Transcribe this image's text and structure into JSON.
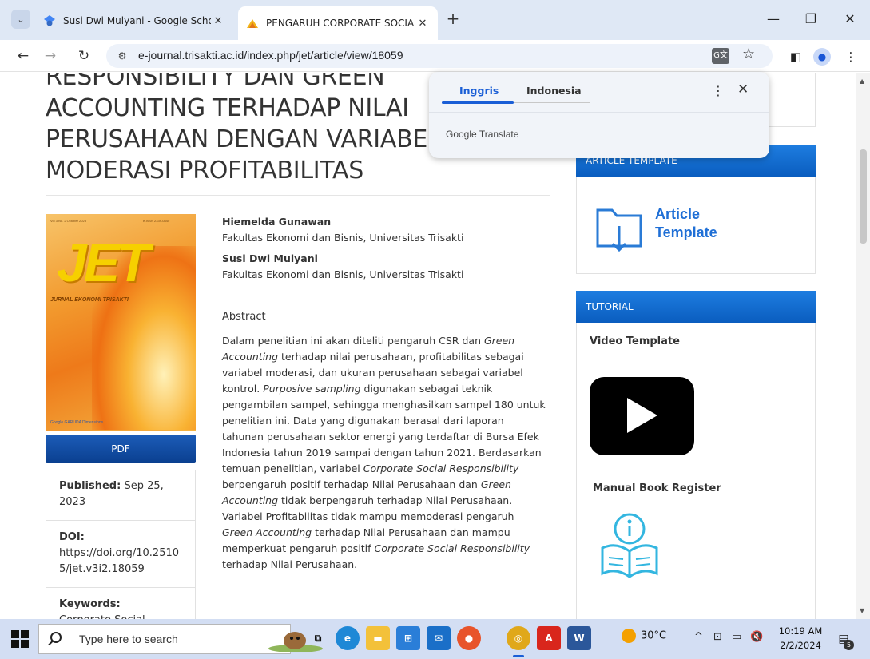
{
  "browser": {
    "tabs": [
      {
        "title": "Susi Dwi Mulyani - Google Scho",
        "active": false
      },
      {
        "title": "PENGARUH CORPORATE SOCIA",
        "active": true
      }
    ],
    "new_tab": "+",
    "close_glyph": "✕",
    "window_controls": {
      "minimize": "—",
      "restore": "❐",
      "close": "✕"
    },
    "url": "e-journal.trisakti.ac.id/index.php/jet/article/view/18059",
    "icons": [
      "tab-search-icon",
      "back-icon",
      "forward-icon",
      "reload-icon",
      "site-info-icon",
      "translate-icon",
      "bookmark-star-icon",
      "side-panel-icon",
      "profile-icon",
      "more-menu-icon"
    ]
  },
  "translate_popup": {
    "tab_selected": "Inggris",
    "tab_other": "Indonesia",
    "brand": "Google Translate",
    "more": "⋮",
    "close": "✕"
  },
  "article": {
    "title_lines": [
      "RESPONSIBILITY DAN GREEN",
      "ACCOUNTING TERHADAP NILAI",
      "PERUSAHAAN DENGAN VARIABEL",
      "MODERASI PROFITABILITAS"
    ],
    "cover": {
      "top_left": "Vol 3 No. 2 Oktober 2023",
      "top_right": "e-ISSN 2339-0840",
      "big": "JET",
      "sub": "JURNAL EKONOMI TRISAKTI",
      "logos": "Google  GARUDA  Dimensions"
    },
    "pdf_label": "PDF",
    "published_label": "Published:",
    "published_value": "Sep 25, 2023",
    "doi_label": "DOI:",
    "doi_line1": "https://doi.org/10.2510",
    "doi_line2": "5/jet.v3i2.18059",
    "keywords_label": "Keywords:",
    "keywords_value": "Corporate Social",
    "authors": [
      {
        "name": "Hiemelda Gunawan",
        "affiliation": "Fakultas Ekonomi dan Bisnis, Universitas Trisakti"
      },
      {
        "name": "Susi Dwi Mulyani",
        "affiliation": "Fakultas Ekonomi dan Bisnis, Universitas Trisakti"
      }
    ],
    "abstract_label": "Abstract",
    "abstract_lines": [
      "Dalam penelitian ini akan diteliti pengaruh CSR dan Green",
      "Accounting terhadap nilai perusahaan, profitabilitas sebagai",
      "variabel moderasi, dan ukuran perusahaan sebagai variabel",
      "kontrol. Purposive sampling digunakan sebagai teknik",
      "pengambilan sampel, sehingga menghasilkan sampel 180 untuk",
      "penelitian ini. Data yang digunakan berasal dari laporan",
      "tahunan perusahaan sektor energi yang terdaftar di Bursa Efek",
      "Indonesia tahun 2019 sampai dengan tahun 2021. Berdasarkan",
      "temuan penelitian, variabel Corporate Social Responsibility",
      "berpengaruh positif terhadap Nilai Perusahaan dan Green",
      "Accounting tidak berpengaruh terhadap Nilai Perusahaan.",
      "Variabel Profitabilitas tidak mampu memoderasi pengaruh",
      "Green Accounting terhadap Nilai Perusahaan dan mampu",
      "memperkuat pengaruh positif Corporate Social Responsibility",
      "terhadap Nilai Perusahaan."
    ]
  },
  "sidebar": {
    "article_template_header": "ARTICLE TEMPLATE",
    "article_template_text_1": "Article",
    "article_template_text_2": "Template",
    "tutorial_header": "TUTORIAL",
    "video_label": "Video Template",
    "manual_label": "Manual Book Register"
  },
  "taskbar": {
    "search_placeholder": "Type here to search",
    "weather": "30°C",
    "time": "10:19 AM",
    "date": "2/2/2024",
    "notification_count": "5",
    "apps": [
      "task-view-icon",
      "edge-icon",
      "file-explorer-icon",
      "store-icon",
      "mail-icon",
      "firefox-icon",
      "chrome-icon",
      "acrobat-icon",
      "word-icon"
    ]
  },
  "colors": {
    "accent_blue": "#1a5ed6",
    "sidebar_header": "#0a5dbf",
    "pdf_button": "#0a3f8f",
    "tab_strip": "#dfe8f5",
    "taskbar": "#d3def3"
  }
}
